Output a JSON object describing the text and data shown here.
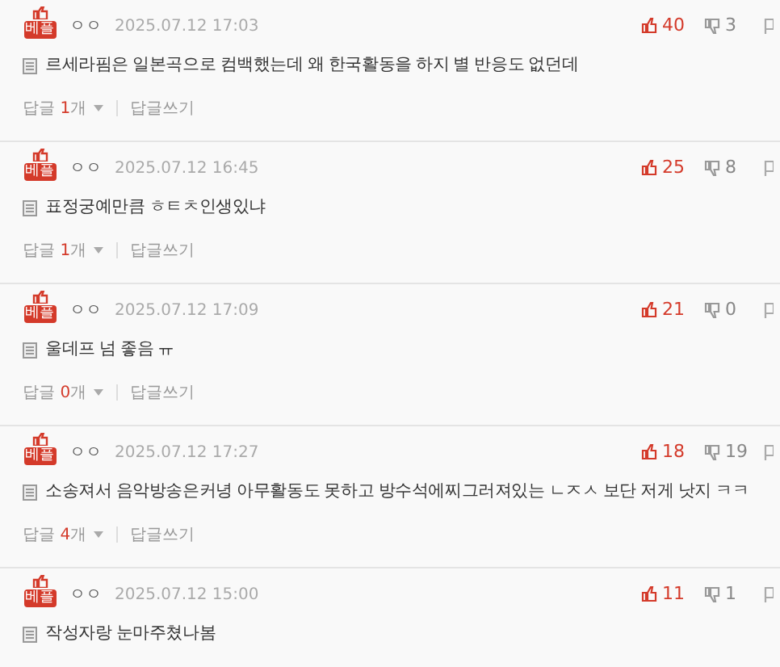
{
  "comments": [
    {
      "badge": "베플",
      "author": "ㅇㅇ",
      "date": "2025.07.12 17:03",
      "likes": "40",
      "dislikes": "3",
      "text": "르세라핌은 일본곡으로 컴백했는데 왜 한국활동을 하지 별 반응도 없던데",
      "reply_label": "답글",
      "reply_count": "1",
      "reply_unit": "개",
      "write_reply": "답글쓰기"
    },
    {
      "badge": "베플",
      "author": "ㅇㅇ",
      "date": "2025.07.12 16:45",
      "likes": "25",
      "dislikes": "8",
      "text": "표정궁예만큼 ㅎㅌㅊ인생있냐",
      "reply_label": "답글",
      "reply_count": "1",
      "reply_unit": "개",
      "write_reply": "답글쓰기"
    },
    {
      "badge": "베플",
      "author": "ㅇㅇ",
      "date": "2025.07.12 17:09",
      "likes": "21",
      "dislikes": "0",
      "text": "울데프 넘 좋음 ㅠ",
      "reply_label": "답글",
      "reply_count": "0",
      "reply_unit": "개",
      "write_reply": "답글쓰기"
    },
    {
      "badge": "베플",
      "author": "ㅇㅇ",
      "date": "2025.07.12 17:27",
      "likes": "18",
      "dislikes": "19",
      "text": "소송져서 음악방송은커녕 아무활동도 못하고 방수석에찌그러져있는 ㄴㅈㅅ 보단 저게 낫지 ㅋㅋ",
      "reply_label": "답글",
      "reply_count": "4",
      "reply_unit": "개",
      "write_reply": "답글쓰기"
    },
    {
      "badge": "베플",
      "author": "ㅇㅇ",
      "date": "2025.07.12 15:00",
      "likes": "11",
      "dislikes": "1",
      "text": "작성자랑 눈마주쳤나봄"
    }
  ]
}
